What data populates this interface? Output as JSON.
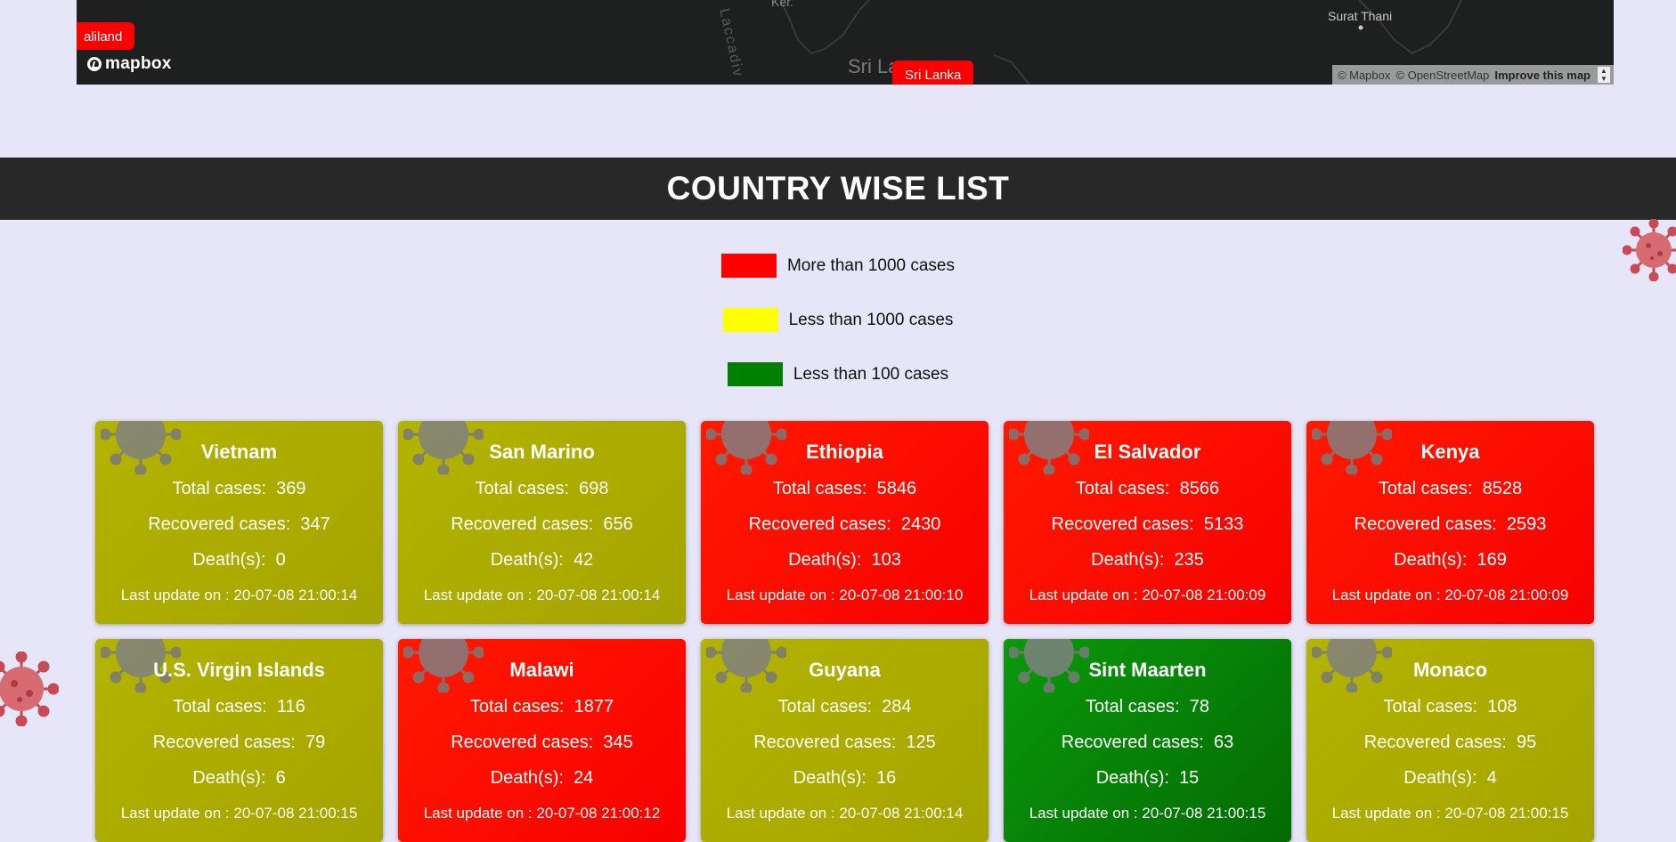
{
  "map": {
    "places": [
      "Surat Thani",
      "Sri La",
      "Laccadiv",
      "Ker."
    ],
    "markers": [
      "aliland",
      "Sri Lanka"
    ],
    "logo_text": "mapbox",
    "attribution": {
      "mapbox": "© Mapbox",
      "osm": "© OpenStreetMap",
      "improve": "Improve this map"
    }
  },
  "section": {
    "title": "COUNTRY WISE LIST"
  },
  "legend": [
    {
      "color": "#ff0000",
      "label": "More than 1000 cases"
    },
    {
      "color": "#ffff00",
      "label": "Less than 1000 cases"
    },
    {
      "color": "#008000",
      "label": "Less than 100 cases"
    }
  ],
  "labels": {
    "total": "Total cases:",
    "recovered": "Recovered cases:",
    "deaths": "Death(s):",
    "updated": "Last update on :"
  },
  "countries": [
    {
      "name": "Vietnam",
      "total": "369",
      "recovered": "347",
      "deaths": "0",
      "updated": "20-07-08 21:00:14",
      "level": "yellow"
    },
    {
      "name": "San Marino",
      "total": "698",
      "recovered": "656",
      "deaths": "42",
      "updated": "20-07-08 21:00:14",
      "level": "yellow"
    },
    {
      "name": "Ethiopia",
      "total": "5846",
      "recovered": "2430",
      "deaths": "103",
      "updated": "20-07-08 21:00:10",
      "level": "red"
    },
    {
      "name": "El Salvador",
      "total": "8566",
      "recovered": "5133",
      "deaths": "235",
      "updated": "20-07-08 21:00:09",
      "level": "red"
    },
    {
      "name": "Kenya",
      "total": "8528",
      "recovered": "2593",
      "deaths": "169",
      "updated": "20-07-08 21:00:09",
      "level": "red"
    },
    {
      "name": "U.S. Virgin Islands",
      "total": "116",
      "recovered": "79",
      "deaths": "6",
      "updated": "20-07-08 21:00:15",
      "level": "yellow"
    },
    {
      "name": "Malawi",
      "total": "1877",
      "recovered": "345",
      "deaths": "24",
      "updated": "20-07-08 21:00:12",
      "level": "red"
    },
    {
      "name": "Guyana",
      "total": "284",
      "recovered": "125",
      "deaths": "16",
      "updated": "20-07-08 21:00:14",
      "level": "yellow"
    },
    {
      "name": "Sint Maarten",
      "total": "78",
      "recovered": "63",
      "deaths": "15",
      "updated": "20-07-08 21:00:15",
      "level": "green"
    },
    {
      "name": "Monaco",
      "total": "108",
      "recovered": "95",
      "deaths": "4",
      "updated": "20-07-08 21:00:15",
      "level": "yellow"
    }
  ]
}
